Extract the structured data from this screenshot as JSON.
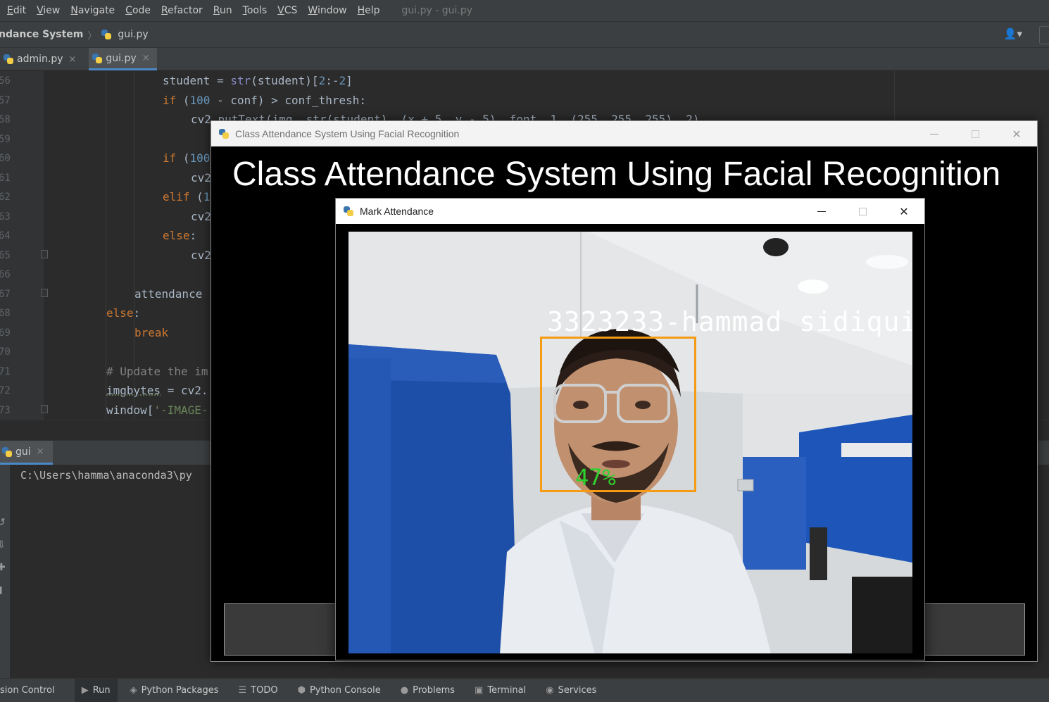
{
  "menu": {
    "items": [
      {
        "mnemonic": "E",
        "rest": "dit"
      },
      {
        "mnemonic": "V",
        "rest": "iew"
      },
      {
        "mnemonic": "N",
        "rest": "avigate"
      },
      {
        "mnemonic": "C",
        "rest": "ode"
      },
      {
        "mnemonic": "R",
        "rest": "efactor"
      },
      {
        "mnemonic": "R",
        "rest": "un"
      },
      {
        "mnemonic": "T",
        "rest": "ools"
      },
      {
        "mnemonic": "V",
        "rest": "CS"
      },
      {
        "mnemonic": "W",
        "rest": "indow"
      },
      {
        "mnemonic": "H",
        "rest": "elp"
      }
    ],
    "window_title": "gui.py - gui.py"
  },
  "navbar": {
    "project": "ndance System",
    "separator": "〉",
    "file": "gui.py",
    "user_glyph": "👤▾"
  },
  "tabs": [
    {
      "label": "admin.py",
      "close": "×"
    },
    {
      "label": "gui.py",
      "close": "×"
    }
  ],
  "editor": {
    "line_numbers": [
      "56",
      "57",
      "58",
      "59",
      "60",
      "61",
      "62",
      "63",
      "64",
      "65",
      "66",
      "67",
      "68",
      "69",
      "70",
      "71",
      "72",
      "73"
    ]
  },
  "run": {
    "tab_label": "gui",
    "tab_close": "×",
    "output": "C:\\Users\\hamma\\anaconda3\\py"
  },
  "statusbar": {
    "items": [
      {
        "label": "sion Control",
        "glyph": ""
      },
      {
        "label": "Run",
        "glyph": "▶"
      },
      {
        "label": "Python Packages",
        "glyph": "◈"
      },
      {
        "label": "TODO",
        "glyph": "☰"
      },
      {
        "label": "Python Console",
        "glyph": "⬢"
      },
      {
        "label": "Problems",
        "glyph": "●"
      },
      {
        "label": "Terminal",
        "glyph": "▣"
      },
      {
        "label": "Services",
        "glyph": "◉"
      }
    ]
  },
  "app_window": {
    "title": "Class Attendance System Using Facial Recognition",
    "heading": "Class Attendance System Using Facial Recognition",
    "min_glyph": "",
    "close_glyph": "✕"
  },
  "mark_window": {
    "title": "Mark Attendance",
    "close_glyph": "✕"
  },
  "camera": {
    "student_label": "3323233-hammad sidiqui",
    "confidence": "47%"
  },
  "colors": {
    "face_box": "#f59b14",
    "confidence_text": "#2fd12f",
    "tab_accent": "#4a88c7"
  }
}
